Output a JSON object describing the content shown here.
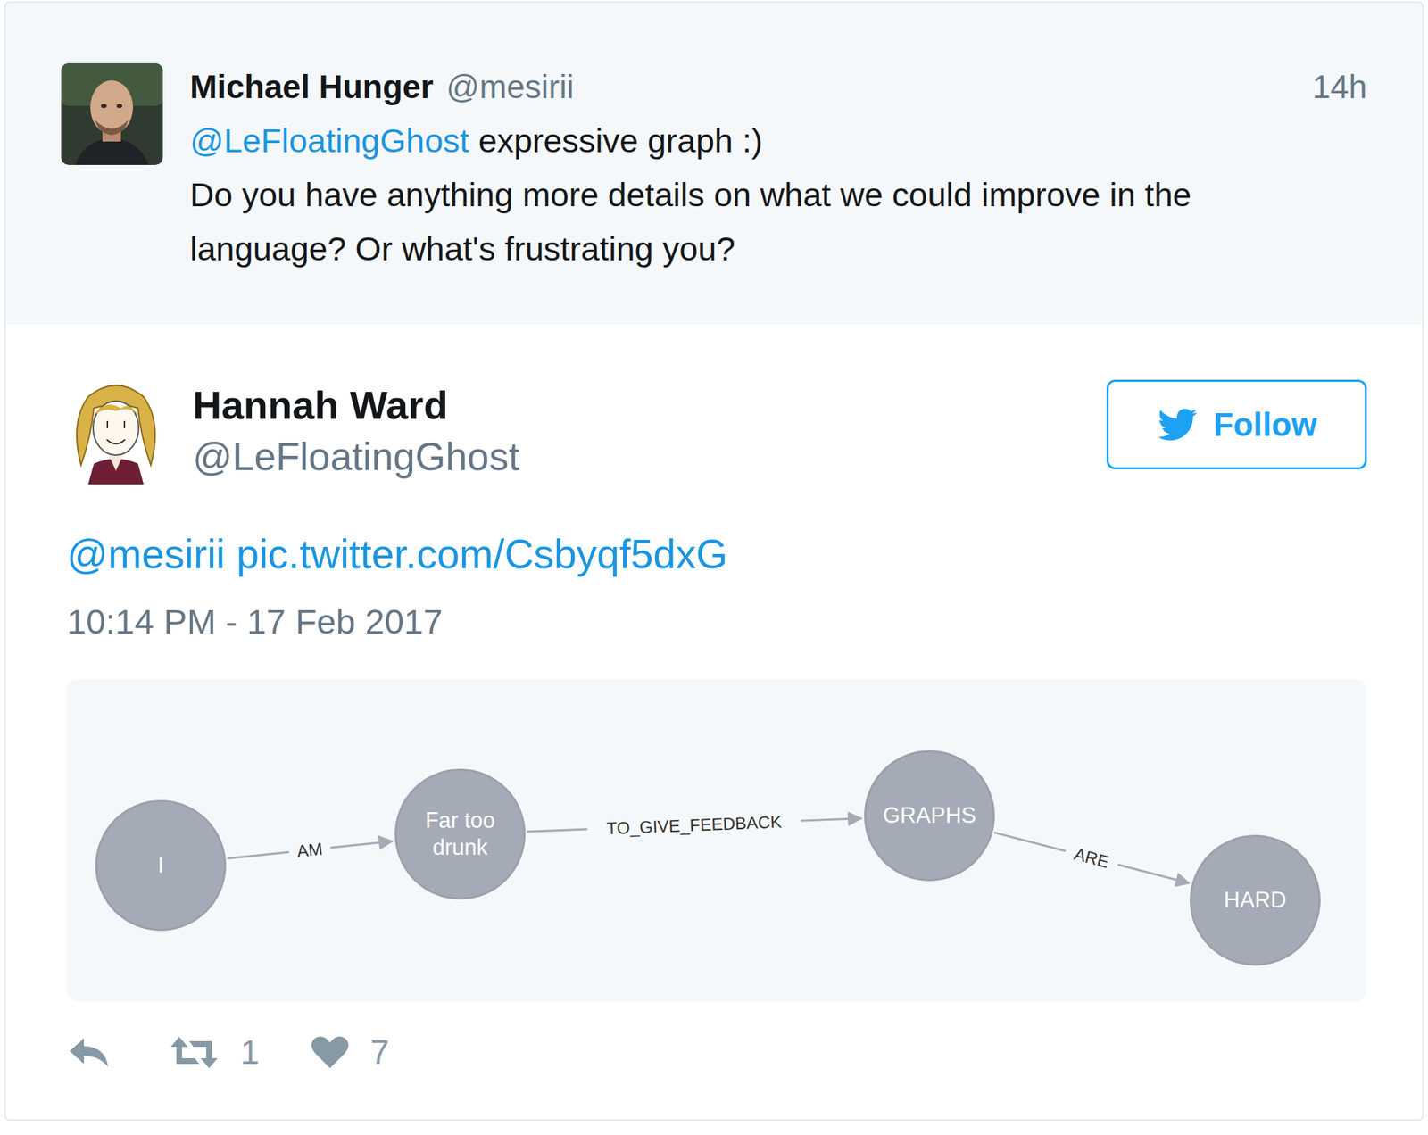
{
  "parent_tweet": {
    "author": "Michael Hunger",
    "handle": "@mesirii",
    "time": "14h",
    "mention": "@LeFloatingGhost",
    "first_line": "expressive graph :)",
    "body": "Do you have anything more details on what we could improve in the language? Or what's frustrating you?"
  },
  "tweet": {
    "author": "Hannah Ward",
    "handle": "@LeFloatingGhost",
    "follow_button": "Follow",
    "following": false,
    "mention": "@mesirii",
    "link": "pic.twitter.com/Csbyqf5dxG",
    "timestamp": "10:14 PM - 17 Feb 2017",
    "graph": {
      "nodes": [
        "I",
        "Far too drunk",
        "GRAPHS",
        "HARD"
      ],
      "edges": [
        {
          "from": 0,
          "to": 1,
          "label": "AM"
        },
        {
          "from": 1,
          "to": 2,
          "label": "TO_GIVE_FEEDBACK"
        },
        {
          "from": 2,
          "to": 3,
          "label": "ARE"
        }
      ]
    },
    "actions": {
      "retweets": "1",
      "likes": "7",
      "liked": false
    }
  }
}
